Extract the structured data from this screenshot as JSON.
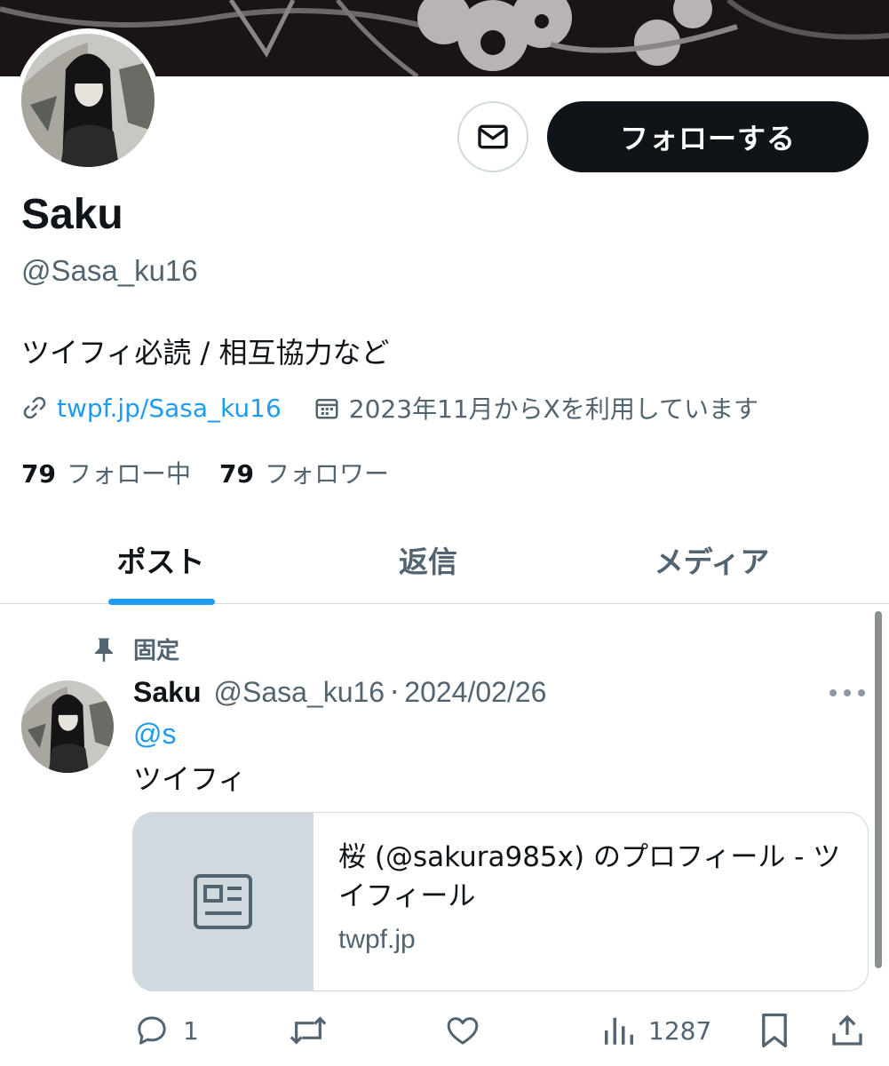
{
  "profile": {
    "display_name": "Saku",
    "handle": "@Sasa_ku16",
    "bio": "ツイフィ必読 / 相互協力など",
    "link_text": "twpf.jp/Sasa_ku16",
    "joined_text": "2023年11月からXを利用しています",
    "following_count": "79",
    "following_label": "フォロー中",
    "followers_count": "79",
    "followers_label": "フォロワー"
  },
  "buttons": {
    "follow_label": "フォローする"
  },
  "tabs": [
    {
      "label": "ポスト",
      "active": true
    },
    {
      "label": "返信",
      "active": false
    },
    {
      "label": "メディア",
      "active": false
    }
  ],
  "pinned_post": {
    "pinned_label": "固定",
    "author_name": "Saku",
    "author_handle": "@Sasa_ku16",
    "separator": "·",
    "date": "2024/02/26",
    "mention": "@s",
    "text": "ツイフィ",
    "card": {
      "title": "桜 (@sakura985x) のプロフィール - ツイフィール",
      "domain": "twpf.jp"
    },
    "stats": {
      "replies": "1",
      "views": "1287"
    }
  },
  "icons": {
    "message": "envelope-icon",
    "link": "link-icon",
    "calendar": "calendar-icon",
    "pin": "pin-icon",
    "more": "more-icon",
    "card_thumb": "article-icon",
    "reply": "reply-icon",
    "repost": "repost-icon",
    "like": "heart-icon",
    "views": "views-icon",
    "bookmark": "bookmark-icon",
    "share": "share-icon"
  },
  "colors": {
    "accent": "#1d9bf0",
    "text_primary": "#0f1419",
    "text_secondary": "#536471",
    "follow_button": "#0f1419",
    "border": "#cfd9de"
  }
}
